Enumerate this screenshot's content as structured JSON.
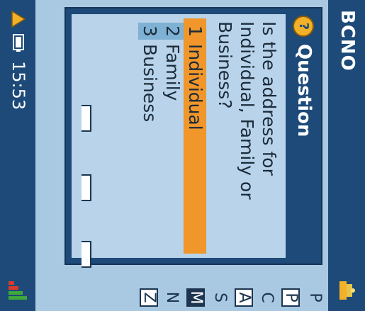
{
  "app": {
    "title": "BCNO"
  },
  "status": {
    "time": "15:53"
  },
  "background_list": [
    "P",
    "P",
    "C",
    "A",
    "S",
    "M",
    "N",
    "Z"
  ],
  "dialog": {
    "title": "Question",
    "question": "Is the address for Individual, Family or Business?",
    "options": [
      {
        "number": "1",
        "label": "Individual",
        "selected": true
      },
      {
        "number": "2",
        "label": "Family",
        "selected": false
      },
      {
        "number": "3",
        "label": "Business",
        "selected": false
      }
    ]
  },
  "colors": {
    "bar": "#1d4a78",
    "screen": "#a9c9e2",
    "selected": "#f0962a"
  },
  "icons": [
    "network-status-icon",
    "alert-icon",
    "battery-icon",
    "signal-icon",
    "question-icon"
  ]
}
